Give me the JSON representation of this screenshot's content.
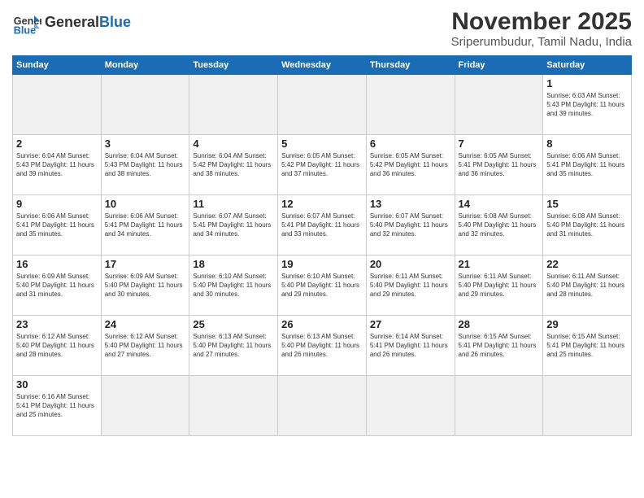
{
  "header": {
    "logo_general": "General",
    "logo_blue": "Blue",
    "month_title": "November 2025",
    "subtitle": "Sriperumbudur, Tamil Nadu, India"
  },
  "weekdays": [
    "Sunday",
    "Monday",
    "Tuesday",
    "Wednesday",
    "Thursday",
    "Friday",
    "Saturday"
  ],
  "weeks": [
    [
      {
        "day": "",
        "info": ""
      },
      {
        "day": "",
        "info": ""
      },
      {
        "day": "",
        "info": ""
      },
      {
        "day": "",
        "info": ""
      },
      {
        "day": "",
        "info": ""
      },
      {
        "day": "",
        "info": ""
      },
      {
        "day": "1",
        "info": "Sunrise: 6:03 AM\nSunset: 5:43 PM\nDaylight: 11 hours\nand 39 minutes."
      }
    ],
    [
      {
        "day": "2",
        "info": "Sunrise: 6:04 AM\nSunset: 5:43 PM\nDaylight: 11 hours\nand 39 minutes."
      },
      {
        "day": "3",
        "info": "Sunrise: 6:04 AM\nSunset: 5:43 PM\nDaylight: 11 hours\nand 38 minutes."
      },
      {
        "day": "4",
        "info": "Sunrise: 6:04 AM\nSunset: 5:42 PM\nDaylight: 11 hours\nand 38 minutes."
      },
      {
        "day": "5",
        "info": "Sunrise: 6:05 AM\nSunset: 5:42 PM\nDaylight: 11 hours\nand 37 minutes."
      },
      {
        "day": "6",
        "info": "Sunrise: 6:05 AM\nSunset: 5:42 PM\nDaylight: 11 hours\nand 36 minutes."
      },
      {
        "day": "7",
        "info": "Sunrise: 6:05 AM\nSunset: 5:41 PM\nDaylight: 11 hours\nand 36 minutes."
      },
      {
        "day": "8",
        "info": "Sunrise: 6:06 AM\nSunset: 5:41 PM\nDaylight: 11 hours\nand 35 minutes."
      }
    ],
    [
      {
        "day": "9",
        "info": "Sunrise: 6:06 AM\nSunset: 5:41 PM\nDaylight: 11 hours\nand 35 minutes."
      },
      {
        "day": "10",
        "info": "Sunrise: 6:06 AM\nSunset: 5:41 PM\nDaylight: 11 hours\nand 34 minutes."
      },
      {
        "day": "11",
        "info": "Sunrise: 6:07 AM\nSunset: 5:41 PM\nDaylight: 11 hours\nand 34 minutes."
      },
      {
        "day": "12",
        "info": "Sunrise: 6:07 AM\nSunset: 5:41 PM\nDaylight: 11 hours\nand 33 minutes."
      },
      {
        "day": "13",
        "info": "Sunrise: 6:07 AM\nSunset: 5:40 PM\nDaylight: 11 hours\nand 32 minutes."
      },
      {
        "day": "14",
        "info": "Sunrise: 6:08 AM\nSunset: 5:40 PM\nDaylight: 11 hours\nand 32 minutes."
      },
      {
        "day": "15",
        "info": "Sunrise: 6:08 AM\nSunset: 5:40 PM\nDaylight: 11 hours\nand 31 minutes."
      }
    ],
    [
      {
        "day": "16",
        "info": "Sunrise: 6:09 AM\nSunset: 5:40 PM\nDaylight: 11 hours\nand 31 minutes."
      },
      {
        "day": "17",
        "info": "Sunrise: 6:09 AM\nSunset: 5:40 PM\nDaylight: 11 hours\nand 30 minutes."
      },
      {
        "day": "18",
        "info": "Sunrise: 6:10 AM\nSunset: 5:40 PM\nDaylight: 11 hours\nand 30 minutes."
      },
      {
        "day": "19",
        "info": "Sunrise: 6:10 AM\nSunset: 5:40 PM\nDaylight: 11 hours\nand 29 minutes."
      },
      {
        "day": "20",
        "info": "Sunrise: 6:11 AM\nSunset: 5:40 PM\nDaylight: 11 hours\nand 29 minutes."
      },
      {
        "day": "21",
        "info": "Sunrise: 6:11 AM\nSunset: 5:40 PM\nDaylight: 11 hours\nand 29 minutes."
      },
      {
        "day": "22",
        "info": "Sunrise: 6:11 AM\nSunset: 5:40 PM\nDaylight: 11 hours\nand 28 minutes."
      }
    ],
    [
      {
        "day": "23",
        "info": "Sunrise: 6:12 AM\nSunset: 5:40 PM\nDaylight: 11 hours\nand 28 minutes."
      },
      {
        "day": "24",
        "info": "Sunrise: 6:12 AM\nSunset: 5:40 PM\nDaylight: 11 hours\nand 27 minutes."
      },
      {
        "day": "25",
        "info": "Sunrise: 6:13 AM\nSunset: 5:40 PM\nDaylight: 11 hours\nand 27 minutes."
      },
      {
        "day": "26",
        "info": "Sunrise: 6:13 AM\nSunset: 5:40 PM\nDaylight: 11 hours\nand 26 minutes."
      },
      {
        "day": "27",
        "info": "Sunrise: 6:14 AM\nSunset: 5:41 PM\nDaylight: 11 hours\nand 26 minutes."
      },
      {
        "day": "28",
        "info": "Sunrise: 6:15 AM\nSunset: 5:41 PM\nDaylight: 11 hours\nand 26 minutes."
      },
      {
        "day": "29",
        "info": "Sunrise: 6:15 AM\nSunset: 5:41 PM\nDaylight: 11 hours\nand 25 minutes."
      }
    ],
    [
      {
        "day": "30",
        "info": "Sunrise: 6:16 AM\nSunset: 5:41 PM\nDaylight: 11 hours\nand 25 minutes."
      },
      {
        "day": "",
        "info": ""
      },
      {
        "day": "",
        "info": ""
      },
      {
        "day": "",
        "info": ""
      },
      {
        "day": "",
        "info": ""
      },
      {
        "day": "",
        "info": ""
      },
      {
        "day": "",
        "info": ""
      }
    ]
  ]
}
